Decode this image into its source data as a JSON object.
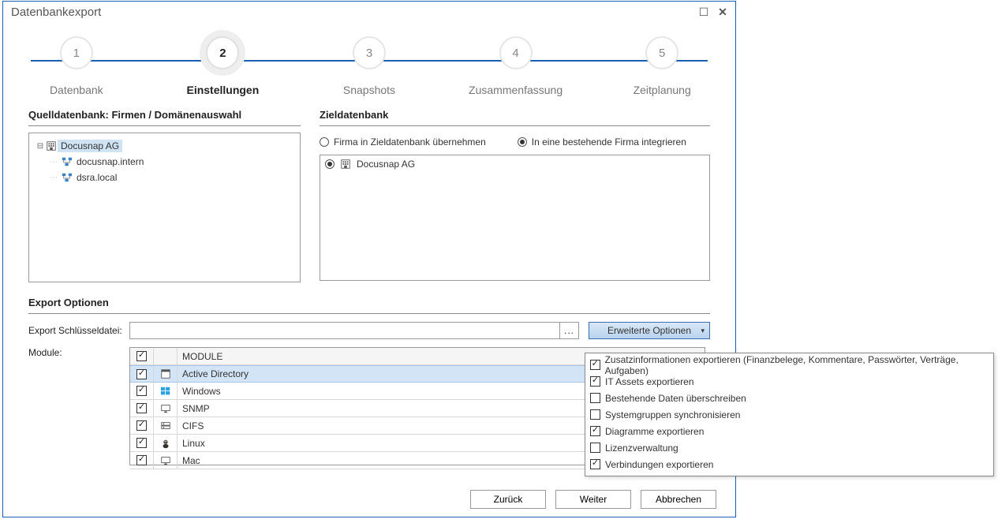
{
  "window": {
    "title": "Datenbankexport"
  },
  "wizard": {
    "steps": [
      {
        "num": "1",
        "label": "Datenbank"
      },
      {
        "num": "2",
        "label": "Einstellungen"
      },
      {
        "num": "3",
        "label": "Snapshots"
      },
      {
        "num": "4",
        "label": "Zusammenfassung"
      },
      {
        "num": "5",
        "label": "Zeitplanung"
      }
    ],
    "active_index": 1
  },
  "source": {
    "heading": "Quelldatenbank: Firmen / Domänenauswahl",
    "tree": {
      "root": "Docusnap AG",
      "children": [
        "docusnap.intern",
        "dsra.local"
      ]
    }
  },
  "target": {
    "heading": "Zieldatenbank",
    "radio_new": "Firma in Zieldatenbank übernehmen",
    "radio_existing": "In eine bestehende Firma integrieren",
    "selected_radio": "existing",
    "firm": "Docusnap AG"
  },
  "export": {
    "heading": "Export Optionen",
    "key_label": "Export Schlüsseldatei:",
    "key_value": "",
    "advanced_label": "Erweiterte Optionen",
    "module_label": "Module:",
    "module_header": "MODULE",
    "modules": [
      {
        "name": "Active Directory",
        "checked": true,
        "icon": "dir",
        "selected": true
      },
      {
        "name": "Windows",
        "checked": true,
        "icon": "win"
      },
      {
        "name": "SNMP",
        "checked": true,
        "icon": "mon"
      },
      {
        "name": "CIFS",
        "checked": true,
        "icon": "srv"
      },
      {
        "name": "Linux",
        "checked": true,
        "icon": "linux"
      },
      {
        "name": "Mac",
        "checked": true,
        "icon": "mon"
      }
    ]
  },
  "advanced_popup": {
    "options": [
      {
        "label": "Zusatzinformationen exportieren (Finanzbelege, Kommentare, Passwörter, Verträge, Aufgaben)",
        "checked": true
      },
      {
        "label": "IT Assets exportieren",
        "checked": true
      },
      {
        "label": "Bestehende Daten überschreiben",
        "checked": false
      },
      {
        "label": "Systemgruppen synchronisieren",
        "checked": false
      },
      {
        "label": "Diagramme exportieren",
        "checked": true
      },
      {
        "label": "Lizenzverwaltung",
        "checked": false
      },
      {
        "label": "Verbindungen exportieren",
        "checked": true
      }
    ]
  },
  "footer": {
    "back": "Zurück",
    "next": "Weiter",
    "cancel": "Abbrechen"
  }
}
